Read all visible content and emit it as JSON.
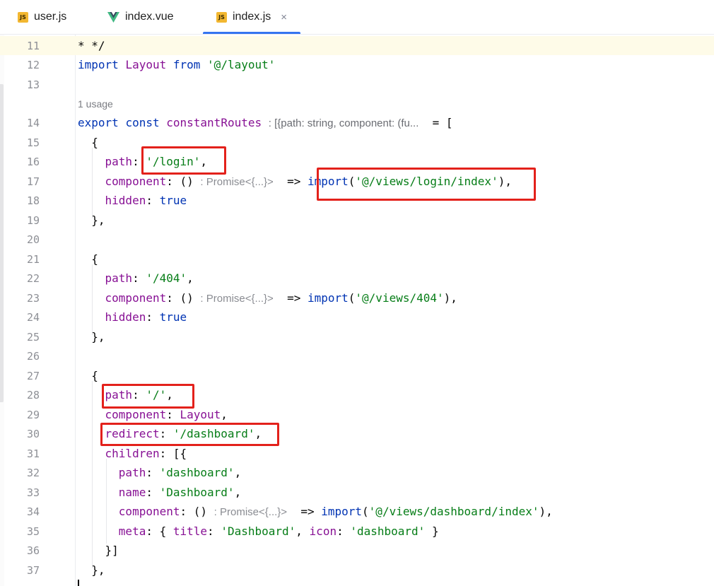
{
  "tabs": [
    {
      "label": "user.js",
      "icon": "javascript-file-icon",
      "active": false
    },
    {
      "label": "index.vue",
      "icon": "vue-file-icon",
      "active": false
    },
    {
      "label": "index.js",
      "icon": "javascript-file-icon",
      "active": true,
      "close": "×"
    }
  ],
  "icons": {
    "js_badge": "JS"
  },
  "colors": {
    "keyword": "#0033b3",
    "string": "#067d17",
    "property": "#871094",
    "highlight_box": "#e3211b",
    "active_tab": "#3574f0"
  },
  "usage_hint": "1 usage",
  "hints": {
    "type_hint": ": [{path: string, component: (fu...",
    "promise": ": Promise<{...}>"
  },
  "lines": [
    {
      "n": "11"
    },
    {
      "n": "12"
    },
    {
      "n": "13"
    },
    {
      "n": "14"
    },
    {
      "n": "15"
    },
    {
      "n": "16"
    },
    {
      "n": "17"
    },
    {
      "n": "18"
    },
    {
      "n": "19"
    },
    {
      "n": "20"
    },
    {
      "n": "21"
    },
    {
      "n": "22"
    },
    {
      "n": "23"
    },
    {
      "n": "24"
    },
    {
      "n": "25"
    },
    {
      "n": "26"
    },
    {
      "n": "27"
    },
    {
      "n": "28"
    },
    {
      "n": "29"
    },
    {
      "n": "30"
    },
    {
      "n": "31"
    },
    {
      "n": "32"
    },
    {
      "n": "33"
    },
    {
      "n": "34"
    },
    {
      "n": "35"
    },
    {
      "n": "36"
    },
    {
      "n": "37"
    }
  ],
  "tokens": {
    "l11": "* */",
    "import": "import",
    "from": "from",
    "Layout": "Layout",
    "layout_path": "'@/layout'",
    "export": "export",
    "const": "const",
    "constantRoutes": "constantRoutes",
    "eq_bracket": "= [",
    "open_brace": "{",
    "close_brace_comma": "},",
    "path": "path",
    "component": "component",
    "hidden": "hidden",
    "true": "true",
    "redirect": "redirect",
    "children": "children",
    "name": "name",
    "meta": "meta",
    "title": "title",
    "icon": "icon",
    "login_path": "'/login'",
    "login_view": "'@/views/login/index'",
    "p404": "'/404'",
    "view404": "'@/views/404'",
    "root": "'/'",
    "dashboard_redirect": "'/dashboard'",
    "dashboard": "'dashboard'",
    "Dashboard": "'Dashboard'",
    "dashboard_view": "'@/views/dashboard/index'",
    "arrow_fn": "()",
    "arrow": "=>",
    "children_open": "[{",
    "children_close": "}]",
    "meta_open": "{",
    "meta_close": "}"
  }
}
